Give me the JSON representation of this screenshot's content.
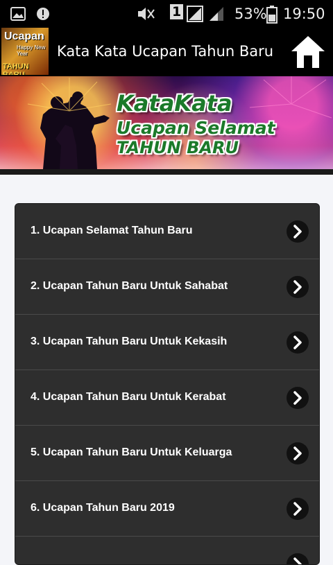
{
  "statusbar": {
    "battery_percent": "53%",
    "time": "19:50",
    "sim_slot": "1",
    "icons": [
      "image-icon",
      "alert-icon",
      "mute-icon",
      "sim-icon",
      "signal-icon",
      "battery-icon"
    ]
  },
  "appbar": {
    "title": "Kata Kata Ucapan Tahun Baru",
    "logo_text": [
      "Ucapan",
      "Happy New Year",
      "TAHUN BARU"
    ],
    "home_icon": "home-icon"
  },
  "banner": {
    "line1": "KataKata",
    "line2": "Ucapan Selamat",
    "line3": "TAHUN BARU"
  },
  "menu": {
    "items": [
      {
        "label": "1. Ucapan Selamat Tahun Baru"
      },
      {
        "label": "2. Ucapan Tahun Baru Untuk Sahabat"
      },
      {
        "label": "3. Ucapan Tahun Baru Untuk Kekasih"
      },
      {
        "label": "4. Ucapan Tahun Baru Untuk Kerabat"
      },
      {
        "label": "5. Ucapan Tahun Baru Untuk Keluarga"
      },
      {
        "label": "6. Ucapan Tahun Baru 2019"
      },
      {
        "label": ""
      }
    ],
    "chevron_icon": "chevron-right-icon"
  },
  "colors": {
    "statusbar_bg": "#000000",
    "appbar_bg": "#000000",
    "page_bg": "#f4f5f9",
    "menu_bg": "#2e2e2e",
    "banner_text": "#1b7a2a"
  }
}
